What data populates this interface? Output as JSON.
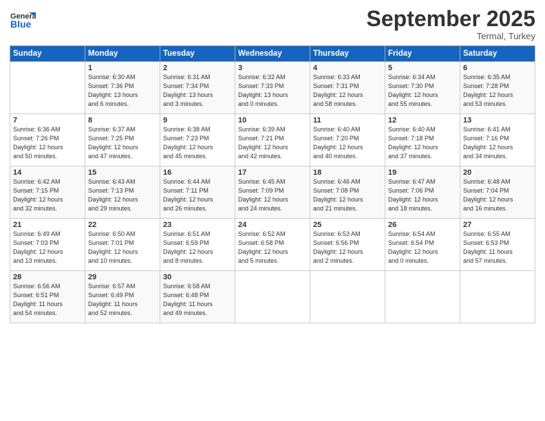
{
  "logo": {
    "general": "General",
    "blue": "Blue"
  },
  "header": {
    "month": "September 2025",
    "location": "Termal, Turkey"
  },
  "weekdays": [
    "Sunday",
    "Monday",
    "Tuesday",
    "Wednesday",
    "Thursday",
    "Friday",
    "Saturday"
  ],
  "weeks": [
    [
      {
        "day": "",
        "info": ""
      },
      {
        "day": "1",
        "info": "Sunrise: 6:30 AM\nSunset: 7:36 PM\nDaylight: 13 hours\nand 6 minutes."
      },
      {
        "day": "2",
        "info": "Sunrise: 6:31 AM\nSunset: 7:34 PM\nDaylight: 13 hours\nand 3 minutes."
      },
      {
        "day": "3",
        "info": "Sunrise: 6:32 AM\nSunset: 7:33 PM\nDaylight: 13 hours\nand 0 minutes."
      },
      {
        "day": "4",
        "info": "Sunrise: 6:33 AM\nSunset: 7:31 PM\nDaylight: 12 hours\nand 58 minutes."
      },
      {
        "day": "5",
        "info": "Sunrise: 6:34 AM\nSunset: 7:30 PM\nDaylight: 12 hours\nand 55 minutes."
      },
      {
        "day": "6",
        "info": "Sunrise: 6:35 AM\nSunset: 7:28 PM\nDaylight: 12 hours\nand 53 minutes."
      }
    ],
    [
      {
        "day": "7",
        "info": "Sunrise: 6:36 AM\nSunset: 7:26 PM\nDaylight: 12 hours\nand 50 minutes."
      },
      {
        "day": "8",
        "info": "Sunrise: 6:37 AM\nSunset: 7:25 PM\nDaylight: 12 hours\nand 47 minutes."
      },
      {
        "day": "9",
        "info": "Sunrise: 6:38 AM\nSunset: 7:23 PM\nDaylight: 12 hours\nand 45 minutes."
      },
      {
        "day": "10",
        "info": "Sunrise: 6:39 AM\nSunset: 7:21 PM\nDaylight: 12 hours\nand 42 minutes."
      },
      {
        "day": "11",
        "info": "Sunrise: 6:40 AM\nSunset: 7:20 PM\nDaylight: 12 hours\nand 40 minutes."
      },
      {
        "day": "12",
        "info": "Sunrise: 6:40 AM\nSunset: 7:18 PM\nDaylight: 12 hours\nand 37 minutes."
      },
      {
        "day": "13",
        "info": "Sunrise: 6:41 AM\nSunset: 7:16 PM\nDaylight: 12 hours\nand 34 minutes."
      }
    ],
    [
      {
        "day": "14",
        "info": "Sunrise: 6:42 AM\nSunset: 7:15 PM\nDaylight: 12 hours\nand 32 minutes."
      },
      {
        "day": "15",
        "info": "Sunrise: 6:43 AM\nSunset: 7:13 PM\nDaylight: 12 hours\nand 29 minutes."
      },
      {
        "day": "16",
        "info": "Sunrise: 6:44 AM\nSunset: 7:11 PM\nDaylight: 12 hours\nand 26 minutes."
      },
      {
        "day": "17",
        "info": "Sunrise: 6:45 AM\nSunset: 7:09 PM\nDaylight: 12 hours\nand 24 minutes."
      },
      {
        "day": "18",
        "info": "Sunrise: 6:46 AM\nSunset: 7:08 PM\nDaylight: 12 hours\nand 21 minutes."
      },
      {
        "day": "19",
        "info": "Sunrise: 6:47 AM\nSunset: 7:06 PM\nDaylight: 12 hours\nand 18 minutes."
      },
      {
        "day": "20",
        "info": "Sunrise: 6:48 AM\nSunset: 7:04 PM\nDaylight: 12 hours\nand 16 minutes."
      }
    ],
    [
      {
        "day": "21",
        "info": "Sunrise: 6:49 AM\nSunset: 7:03 PM\nDaylight: 12 hours\nand 13 minutes."
      },
      {
        "day": "22",
        "info": "Sunrise: 6:50 AM\nSunset: 7:01 PM\nDaylight: 12 hours\nand 10 minutes."
      },
      {
        "day": "23",
        "info": "Sunrise: 6:51 AM\nSunset: 6:59 PM\nDaylight: 12 hours\nand 8 minutes."
      },
      {
        "day": "24",
        "info": "Sunrise: 6:52 AM\nSunset: 6:58 PM\nDaylight: 12 hours\nand 5 minutes."
      },
      {
        "day": "25",
        "info": "Sunrise: 6:53 AM\nSunset: 6:56 PM\nDaylight: 12 hours\nand 2 minutes."
      },
      {
        "day": "26",
        "info": "Sunrise: 6:54 AM\nSunset: 6:54 PM\nDaylight: 12 hours\nand 0 minutes."
      },
      {
        "day": "27",
        "info": "Sunrise: 6:55 AM\nSunset: 6:53 PM\nDaylight: 11 hours\nand 57 minutes."
      }
    ],
    [
      {
        "day": "28",
        "info": "Sunrise: 6:56 AM\nSunset: 6:51 PM\nDaylight: 11 hours\nand 54 minutes."
      },
      {
        "day": "29",
        "info": "Sunrise: 6:57 AM\nSunset: 6:49 PM\nDaylight: 11 hours\nand 52 minutes."
      },
      {
        "day": "30",
        "info": "Sunrise: 6:58 AM\nSunset: 6:48 PM\nDaylight: 11 hours\nand 49 minutes."
      },
      {
        "day": "",
        "info": ""
      },
      {
        "day": "",
        "info": ""
      },
      {
        "day": "",
        "info": ""
      },
      {
        "day": "",
        "info": ""
      }
    ]
  ]
}
